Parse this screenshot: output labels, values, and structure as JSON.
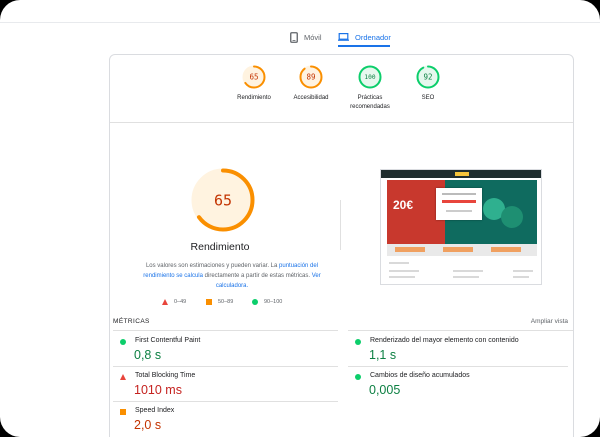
{
  "tabs": {
    "mobile": "Móvil",
    "desktop": "Ordenador"
  },
  "gauges": [
    {
      "score": "65",
      "label": "Rendimiento",
      "color": "#fa8f00",
      "track": "#fff3e0",
      "text": "#c33300",
      "fraction": 0.65
    },
    {
      "score": "89",
      "label": "Accesibilidad",
      "color": "#fa8f00",
      "track": "#fff3e0",
      "text": "#c33300",
      "fraction": 0.89
    },
    {
      "score": "100",
      "label1": "Prácticas",
      "label2": "recomendadas",
      "color": "#0cce6b",
      "track": "#e6f8ee",
      "text": "#0d8043",
      "fraction": 1.0
    },
    {
      "score": "92",
      "label": "SEO",
      "color": "#0cce6b",
      "track": "#e6f8ee",
      "text": "#0d8043",
      "fraction": 0.92
    }
  ],
  "performance": {
    "score": "65",
    "fraction": 0.65,
    "title": "Rendimiento",
    "desc_pre": "Los valores son estimaciones y pueden variar. La ",
    "desc_link1": "puntuación del rendimiento se calcula",
    "desc_mid": " directamente a partir de estas métricas. ",
    "desc_link2": "Ver calculadora.",
    "legend": {
      "bad": "0–49",
      "avg": "50–89",
      "good": "90–100"
    }
  },
  "thumbnail": {
    "hero_text": "20€"
  },
  "metrics": {
    "heading": "MÉTRICAS",
    "expand": "Ampliar vista",
    "items": {
      "fcp": {
        "name": "First Contentful Paint",
        "value": "0,8 s"
      },
      "lcp": {
        "name": "Renderizado del mayor elemento con contenido",
        "value": "1,1 s"
      },
      "tbt": {
        "name": "Total Blocking Time",
        "value": "1010 ms"
      },
      "cls": {
        "name": "Cambios de diseño acumulados",
        "value": "0,005"
      },
      "si": {
        "name": "Speed Index",
        "value": "2,0 s"
      }
    }
  },
  "colors": {
    "accent": "#1a73e8",
    "good": "#0cce6b",
    "average": "#fa8f00",
    "poor": "#e8453c"
  }
}
